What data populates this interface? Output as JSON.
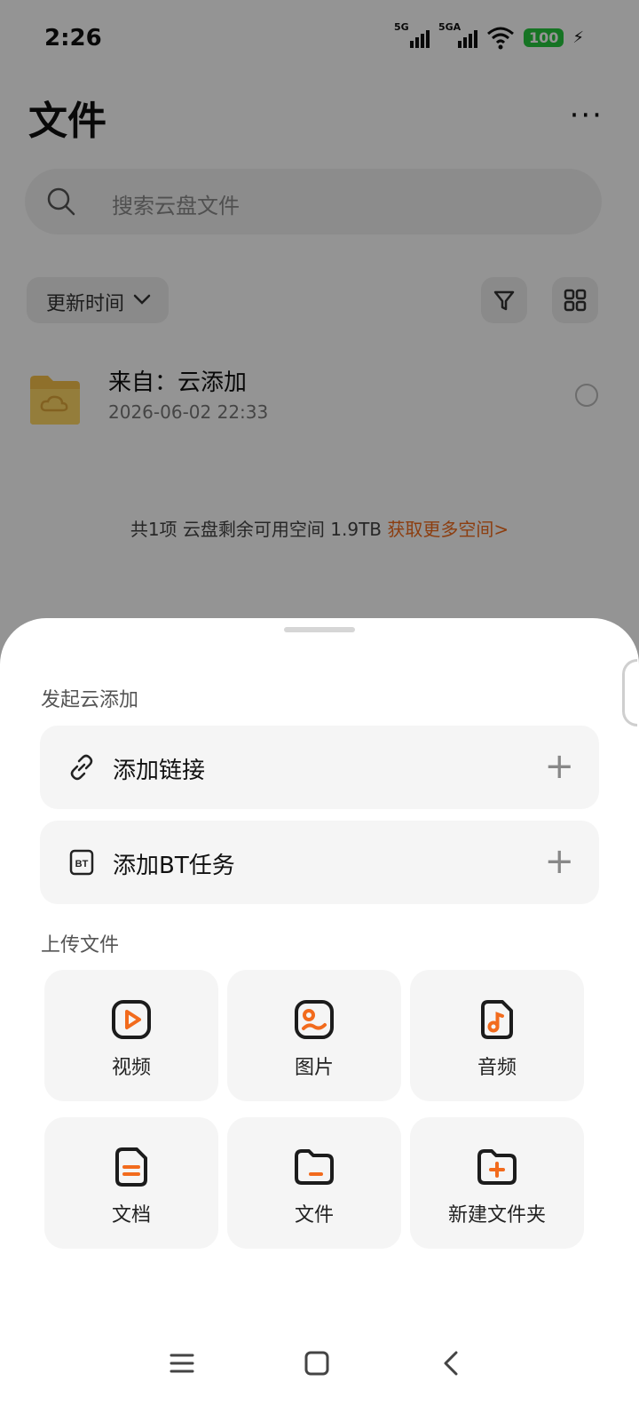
{
  "status": {
    "time": "2:26",
    "sig1": "5G",
    "sig2": "5GA",
    "battery": "100"
  },
  "header": {
    "title": "文件",
    "more": "···"
  },
  "search": {
    "placeholder": "搜索云盘文件"
  },
  "sort": {
    "label": "更新时间"
  },
  "file": {
    "name": "来自：云添加",
    "date": "2026-06-02 22:33"
  },
  "summary": {
    "count": "共1项",
    "space": "云盘剩余可用空间  1.9TB",
    "link": "获取更多空间>"
  },
  "sheet": {
    "section_cloud": "发起云添加",
    "add_link": "添加链接",
    "add_bt": "添加BT任务",
    "section_upload": "上传文件",
    "tiles": [
      "视频",
      "图片",
      "音频",
      "文档",
      "文件",
      "新建文件夹"
    ]
  },
  "colors": {
    "accent": "#f26b1d",
    "battery": "#27c93f"
  }
}
